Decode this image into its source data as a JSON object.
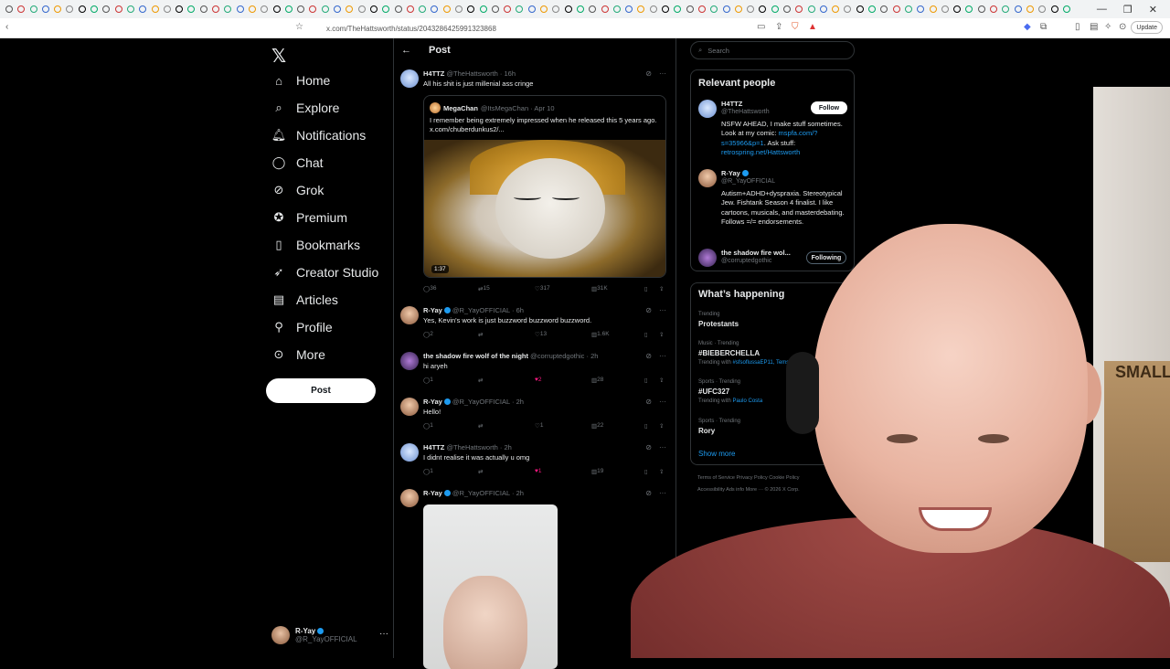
{
  "browser": {
    "url": "x.com/TheHattsworth/status/2043286425991323868",
    "update_label": "Update"
  },
  "nav": {
    "items": [
      {
        "label": "Home",
        "icon": "home-icon"
      },
      {
        "label": "Explore",
        "icon": "search-icon"
      },
      {
        "label": "Notifications",
        "icon": "bell-icon"
      },
      {
        "label": "Chat",
        "icon": "chat-icon"
      },
      {
        "label": "Grok",
        "icon": "grok-icon"
      },
      {
        "label": "Premium",
        "icon": "premium-icon"
      },
      {
        "label": "Bookmarks",
        "icon": "bookmark-icon"
      },
      {
        "label": "Creator Studio",
        "icon": "rocket-icon"
      },
      {
        "label": "Articles",
        "icon": "article-icon"
      },
      {
        "label": "Profile",
        "icon": "person-icon"
      },
      {
        "label": "More",
        "icon": "more-circle-icon"
      }
    ],
    "post_label": "Post",
    "me": {
      "name": "R-Yay",
      "handle": "@R_YayOFFICIAL"
    }
  },
  "feed": {
    "title": "Post",
    "tweets": [
      {
        "name": "H4TTZ",
        "handle": "@TheHattsworth · 16h",
        "text": "All his shit is just millenial ass cringe",
        "quote": {
          "name": "MegaChan",
          "handle": "@ItsMegaChan · Apr 10",
          "text": "I remember being extremely impressed when he released this 5 years ago.  x.com/chuberdunkus2/...",
          "duration": "1:37"
        },
        "replies": "36",
        "reposts": "15",
        "likes": "317",
        "views": "31K"
      },
      {
        "name": "R-Yay",
        "handle": "@R_YayOFFICIAL · 6h",
        "text": "Yes, Kevin's work is just buzzword buzzword buzzword.",
        "replies": "2",
        "reposts": "",
        "likes": "13",
        "views": "1.6K"
      },
      {
        "name": "the shadow fire wolf of the night",
        "handle": "@corruptedgothic · 2h",
        "text": "hi aryeh",
        "replies": "1",
        "reposts": "",
        "likes": "2",
        "views": "28"
      },
      {
        "name": "R-Yay",
        "handle": "@R_YayOFFICIAL · 2h",
        "text": "Hello!",
        "replies": "1",
        "reposts": "",
        "likes": "1",
        "views": "22"
      },
      {
        "name": "H4TTZ",
        "handle": "@TheHattsworth · 2h",
        "text": "I didnt realise it was actually u omg",
        "replies": "1",
        "reposts": "",
        "likes": "1",
        "views": "19"
      },
      {
        "name": "R-Yay",
        "handle": "@R_YayOFFICIAL · 2h",
        "text": ""
      }
    ]
  },
  "sidebar": {
    "search_placeholder": "Search",
    "relevant_title": "Relevant people",
    "people": [
      {
        "name": "H4TTZ",
        "handle": "@TheHattsworth",
        "bio": "NSFW AHEAD, I make stuff sometimes. Look at my comic:",
        "link1": "mspfa.com/?s=35966&p=1",
        "bio2": ". Ask stuff:",
        "link2": "retrospring.net/Hattsworth",
        "button": "Follow"
      },
      {
        "name": "R-Yay",
        "handle": "@R_YayOFFICIAL",
        "bio": "Autism+ADHD+dyspraxia. Stereotypical Jew. Fishtank Season 4 finalist. I like cartoons, musicals, and masterdebating. Follows =/= endorsements."
      },
      {
        "name": "the shadow fire wol...",
        "handle": "@corruptedgothic",
        "button": "Following"
      }
    ],
    "happening_title": "What’s happening",
    "trends": [
      {
        "cat": "Trending",
        "name": "Protestants",
        "with": "",
        "with_links": ""
      },
      {
        "cat": "Music · Trending",
        "name": "#BIEBERCHELLA",
        "with": "Trending with ",
        "with_links": "#sfsoflussaEP11, Tems"
      },
      {
        "cat": "Sports · Trending",
        "name": "#UFC327",
        "with": "Trending with ",
        "with_links": "Paulo Costa"
      },
      {
        "cat": "Sports · Trending",
        "name": "Rory",
        "with": "",
        "with_links": ""
      }
    ],
    "show_more": "Show more",
    "footer1": "Terms of Service    Privacy Policy    Cookie Policy",
    "footer2": "Accessibility    Ads info    More ···    © 2026 X Corp."
  },
  "webcam": {
    "box_text": "SMALL"
  }
}
